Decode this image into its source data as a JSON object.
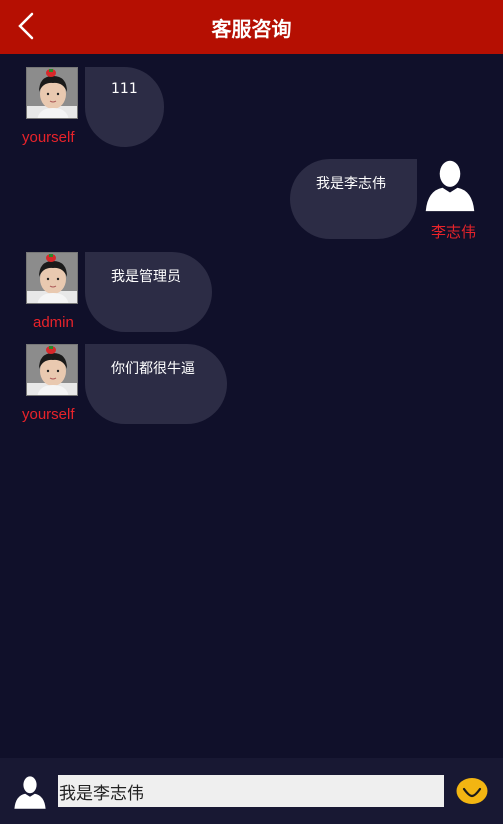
{
  "header": {
    "title": "客服咨询",
    "back_icon": "chevron-left-icon"
  },
  "messages": [
    {
      "side": "left",
      "user": "yourself",
      "text": "111",
      "avatar": "photo-avatar"
    },
    {
      "side": "right",
      "user": "李志伟",
      "text": "我是李志伟",
      "avatar": "person-silhouette-icon"
    },
    {
      "side": "left",
      "user": "admin",
      "text": "我是管理员",
      "avatar": "photo-avatar"
    },
    {
      "side": "left",
      "user": "yourself",
      "text": "你们都很牛逼",
      "avatar": "photo-avatar"
    }
  ],
  "composer": {
    "value": "我是李志伟",
    "avatar_icon": "person-silhouette-icon",
    "send_icon": "checkmark-send-icon"
  },
  "colors": {
    "header_bg": "#b50f02",
    "page_bg": "#10102a",
    "bubble_bg": "#2c2c45",
    "username": "#e8232a",
    "send_button": "#f2b512"
  }
}
